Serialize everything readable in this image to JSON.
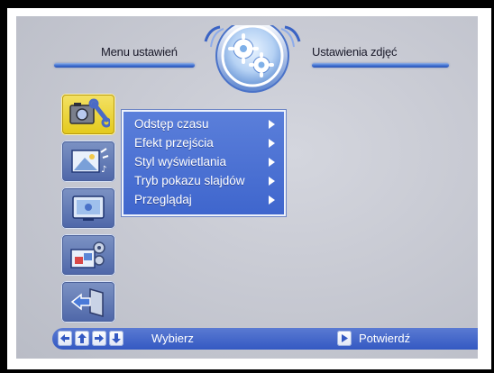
{
  "header": {
    "left_title": "Menu ustawień",
    "right_title": "Ustawienia zdjęć"
  },
  "header_icon": "gears-icon",
  "sidebar": {
    "items": [
      {
        "icon": "photo-settings-icon",
        "active": true
      },
      {
        "icon": "slideshow-transition-icon",
        "active": false
      },
      {
        "icon": "display-icon",
        "active": false
      },
      {
        "icon": "image-config-icon",
        "active": false
      },
      {
        "icon": "exit-door-icon",
        "active": false
      }
    ]
  },
  "menu": {
    "items": [
      {
        "label": "Odstęp czasu"
      },
      {
        "label": "Efekt przejścia"
      },
      {
        "label": "Styl wyświetlania"
      },
      {
        "label": "Tryb pokazu slajdów"
      },
      {
        "label": "Przeglądaj"
      }
    ]
  },
  "footer": {
    "select_label": "Wybierz",
    "confirm_label": "Potwierdź",
    "nav_icons": [
      "arrow-left-icon",
      "arrow-up-icon",
      "arrow-right-icon",
      "arrow-down-icon"
    ],
    "confirm_icon": "play-icon"
  },
  "colors": {
    "accent_blue": "#3f66cd",
    "active_yellow": "#e3c91a",
    "background": "#c8cad3"
  }
}
